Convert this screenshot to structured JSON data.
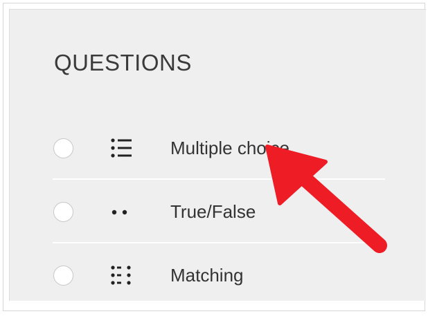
{
  "questions_panel": {
    "heading": "QUESTIONS",
    "items": [
      {
        "label": "Multiple choice",
        "icon": "multiple-choice-list-icon",
        "selected": false
      },
      {
        "label": "True/False",
        "icon": "true-false-dots-icon",
        "selected": false
      },
      {
        "label": "Matching",
        "icon": "matching-grid-icon",
        "selected": false
      }
    ]
  },
  "annotation": {
    "arrow_color": "#ee1c25"
  }
}
